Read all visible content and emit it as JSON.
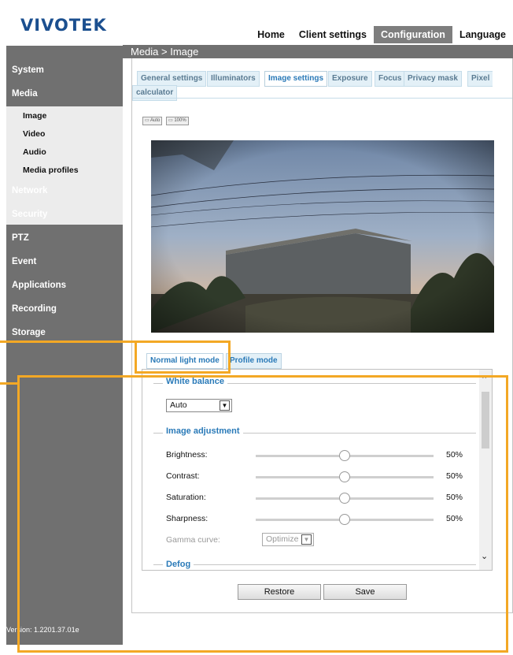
{
  "header": {
    "logo_text": "VIVOTEK",
    "nav": [
      "Home",
      "Client settings",
      "Configuration",
      "Language"
    ],
    "active_nav": "Configuration"
  },
  "sidebar": {
    "items": [
      "System",
      "Media",
      "Network",
      "Security",
      "PTZ",
      "Event",
      "Applications",
      "Recording",
      "Storage"
    ],
    "sub_items": [
      "Image",
      "Video",
      "Audio",
      "Media profiles"
    ],
    "version": "Version: 1.2201.37.01e"
  },
  "page": {
    "breadcrumb": "Media  > Image",
    "tabs": [
      "General settings",
      "Illuminators",
      "Image settings",
      "Exposure",
      "Focus",
      "Privacy mask",
      "Pixel",
      "calculator"
    ],
    "active_tab": "Image settings",
    "zoom_buttons": [
      "Auto",
      "100%"
    ]
  },
  "modes": {
    "tabs": [
      "Normal light mode",
      "Profile mode"
    ],
    "active": "Normal light mode"
  },
  "settings": {
    "white_balance": {
      "legend": "White balance",
      "value": "Auto"
    },
    "image_adjustment": {
      "legend": "Image adjustment",
      "rows": [
        {
          "label": "Brightness:",
          "value": "50%",
          "level": 0.5
        },
        {
          "label": "Contrast:",
          "value": "50%",
          "level": 0.5
        },
        {
          "label": "Saturation:",
          "value": "50%",
          "level": 0.5
        },
        {
          "label": "Sharpness:",
          "value": "50%",
          "level": 0.5
        }
      ],
      "gamma": {
        "label": "Gamma curve:",
        "value": "Optimize"
      }
    },
    "defog": {
      "legend": "Defog"
    }
  },
  "buttons": {
    "restore": "Restore",
    "save": "Save"
  },
  "colors": {
    "accent": "#2a7ab8",
    "highlight": "#f3a825",
    "sidebar": "#707070"
  }
}
